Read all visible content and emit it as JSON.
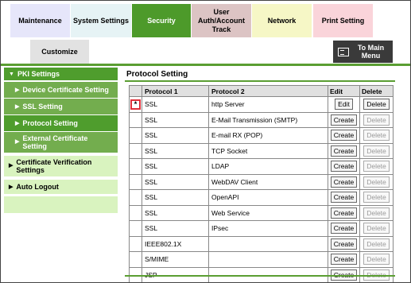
{
  "tabs": {
    "maintenance": "Maintenance",
    "system_settings": "System Settings",
    "security": "Security",
    "user_auth": "User Auth/Account Track",
    "network": "Network",
    "print_setting": "Print Setting",
    "customize": "Customize",
    "main_menu": "To Main Menu"
  },
  "sidebar": {
    "pki": "PKI Settings",
    "device_cert": "Device Certificate Setting",
    "ssl": "SSL Setting",
    "protocol": "Protocol Setting",
    "external_cert": "External Certificate Setting",
    "cert_verification": "Certificate Verification Settings",
    "auto_logout": "Auto Logout"
  },
  "main": {
    "title": "Protocol Setting",
    "headers": {
      "protocol1": "Protocol 1",
      "protocol2": "Protocol 2",
      "edit": "Edit",
      "delete": "Delete"
    },
    "marker": "*",
    "rows": [
      {
        "p1": "SSL",
        "p2": "http Server",
        "action": "Edit",
        "delete": "Delete",
        "delete_enabled": true
      },
      {
        "p1": "SSL",
        "p2": "E-Mail Transmission (SMTP)",
        "action": "Create",
        "delete": "Delete",
        "delete_enabled": false
      },
      {
        "p1": "SSL",
        "p2": "E-mail RX (POP)",
        "action": "Create",
        "delete": "Delete",
        "delete_enabled": false
      },
      {
        "p1": "SSL",
        "p2": "TCP Socket",
        "action": "Create",
        "delete": "Delete",
        "delete_enabled": false
      },
      {
        "p1": "SSL",
        "p2": "LDAP",
        "action": "Create",
        "delete": "Delete",
        "delete_enabled": false
      },
      {
        "p1": "SSL",
        "p2": "WebDAV Client",
        "action": "Create",
        "delete": "Delete",
        "delete_enabled": false
      },
      {
        "p1": "SSL",
        "p2": "OpenAPI",
        "action": "Create",
        "delete": "Delete",
        "delete_enabled": false
      },
      {
        "p1": "SSL",
        "p2": "Web Service",
        "action": "Create",
        "delete": "Delete",
        "delete_enabled": false
      },
      {
        "p1": "SSL",
        "p2": "IPsec",
        "action": "Create",
        "delete": "Delete",
        "delete_enabled": false
      },
      {
        "p1": "IEEE802.1X",
        "p2": "",
        "action": "Create",
        "delete": "Delete",
        "delete_enabled": false
      },
      {
        "p1": "S/MIME",
        "p2": "",
        "action": "Create",
        "delete": "Delete",
        "delete_enabled": false
      },
      {
        "p1": "JSP",
        "p2": "",
        "action": "Create",
        "delete": "Delete",
        "delete_enabled": false
      }
    ]
  },
  "colors": {
    "accent": "#5a9e32",
    "marker_border": "#e0303a"
  }
}
